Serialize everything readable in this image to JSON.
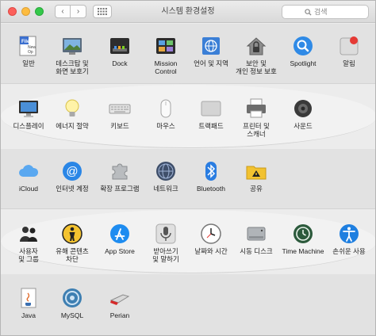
{
  "window": {
    "title": "시스템 환경설정"
  },
  "toolbar": {
    "back_label": "‹",
    "forward_label": "›"
  },
  "search": {
    "placeholder": "검색"
  },
  "colors": {
    "section_shade": "#e2e2e2",
    "section_light": "#f2f2f2",
    "accent_blue": "#1a82fb"
  },
  "sections": [
    {
      "items": [
        {
          "label": "일반",
          "icon": "file-icon"
        },
        {
          "label": "데스크탑 및\n화면 보호기",
          "icon": "desktop-icon"
        },
        {
          "label": "Dock",
          "icon": "dock-icon"
        },
        {
          "label": "Mission\nControl",
          "icon": "mission-control-icon"
        },
        {
          "label": "언어 및 지역",
          "icon": "globe-flag-icon"
        },
        {
          "label": "보안 및\n개인 정보 보호",
          "icon": "house-lock-icon"
        },
        {
          "label": "Spotlight",
          "icon": "magnifier-icon"
        },
        {
          "label": "알림",
          "icon": "notification-icon"
        }
      ]
    },
    {
      "items": [
        {
          "label": "디스플레이",
          "icon": "display-icon"
        },
        {
          "label": "에너지 절약",
          "icon": "lightbulb-icon"
        },
        {
          "label": "키보드",
          "icon": "keyboard-icon"
        },
        {
          "label": "마우스",
          "icon": "mouse-icon"
        },
        {
          "label": "트랙패드",
          "icon": "trackpad-icon"
        },
        {
          "label": "프린터 및\n스캐너",
          "icon": "printer-icon"
        },
        {
          "label": "사운드",
          "icon": "speaker-icon"
        }
      ]
    },
    {
      "items": [
        {
          "label": "iCloud",
          "icon": "cloud-icon"
        },
        {
          "label": "인터넷 계정",
          "icon": "at-sign-icon"
        },
        {
          "label": "확장 프로그램",
          "icon": "puzzle-icon"
        },
        {
          "label": "네트워크",
          "icon": "network-globe-icon"
        },
        {
          "label": "Bluetooth",
          "icon": "bluetooth-icon"
        },
        {
          "label": "공유",
          "icon": "shared-folder-icon"
        }
      ]
    },
    {
      "items": [
        {
          "label": "사용자\n및 그룹",
          "icon": "users-icon"
        },
        {
          "label": "유해 콘텐츠\n차단",
          "icon": "parental-controls-icon"
        },
        {
          "label": "App Store",
          "icon": "app-store-icon"
        },
        {
          "label": "받아쓰기\n및 말하기",
          "icon": "microphone-icon"
        },
        {
          "label": "날짜와 시간",
          "icon": "clock-icon"
        },
        {
          "label": "시동 디스크",
          "icon": "disk-icon"
        },
        {
          "label": "Time Machine",
          "icon": "time-machine-icon"
        },
        {
          "label": "손쉬운 사용",
          "icon": "accessibility-icon"
        }
      ]
    },
    {
      "items": [
        {
          "label": "Java",
          "icon": "java-icon"
        },
        {
          "label": "MySQL",
          "icon": "mysql-icon"
        },
        {
          "label": "Perian",
          "icon": "perian-knife-icon"
        }
      ]
    }
  ]
}
